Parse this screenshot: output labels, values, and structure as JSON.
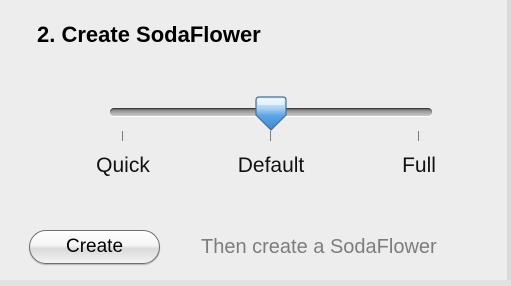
{
  "section": {
    "title": "2. Create SodaFlower"
  },
  "slider": {
    "ticks": [
      "Quick",
      "Default",
      "Full"
    ],
    "selected": "Default",
    "selected_index": 1
  },
  "actions": {
    "create_label": "Create",
    "hint": "Then create a SodaFlower"
  },
  "colors": {
    "panel_background": "#ededed",
    "thumb_accent": "#5ba3e0",
    "hint_text": "#7d7d7d"
  },
  "icons": {
    "slider_thumb": "aqua-pointer-thumb-icon"
  }
}
